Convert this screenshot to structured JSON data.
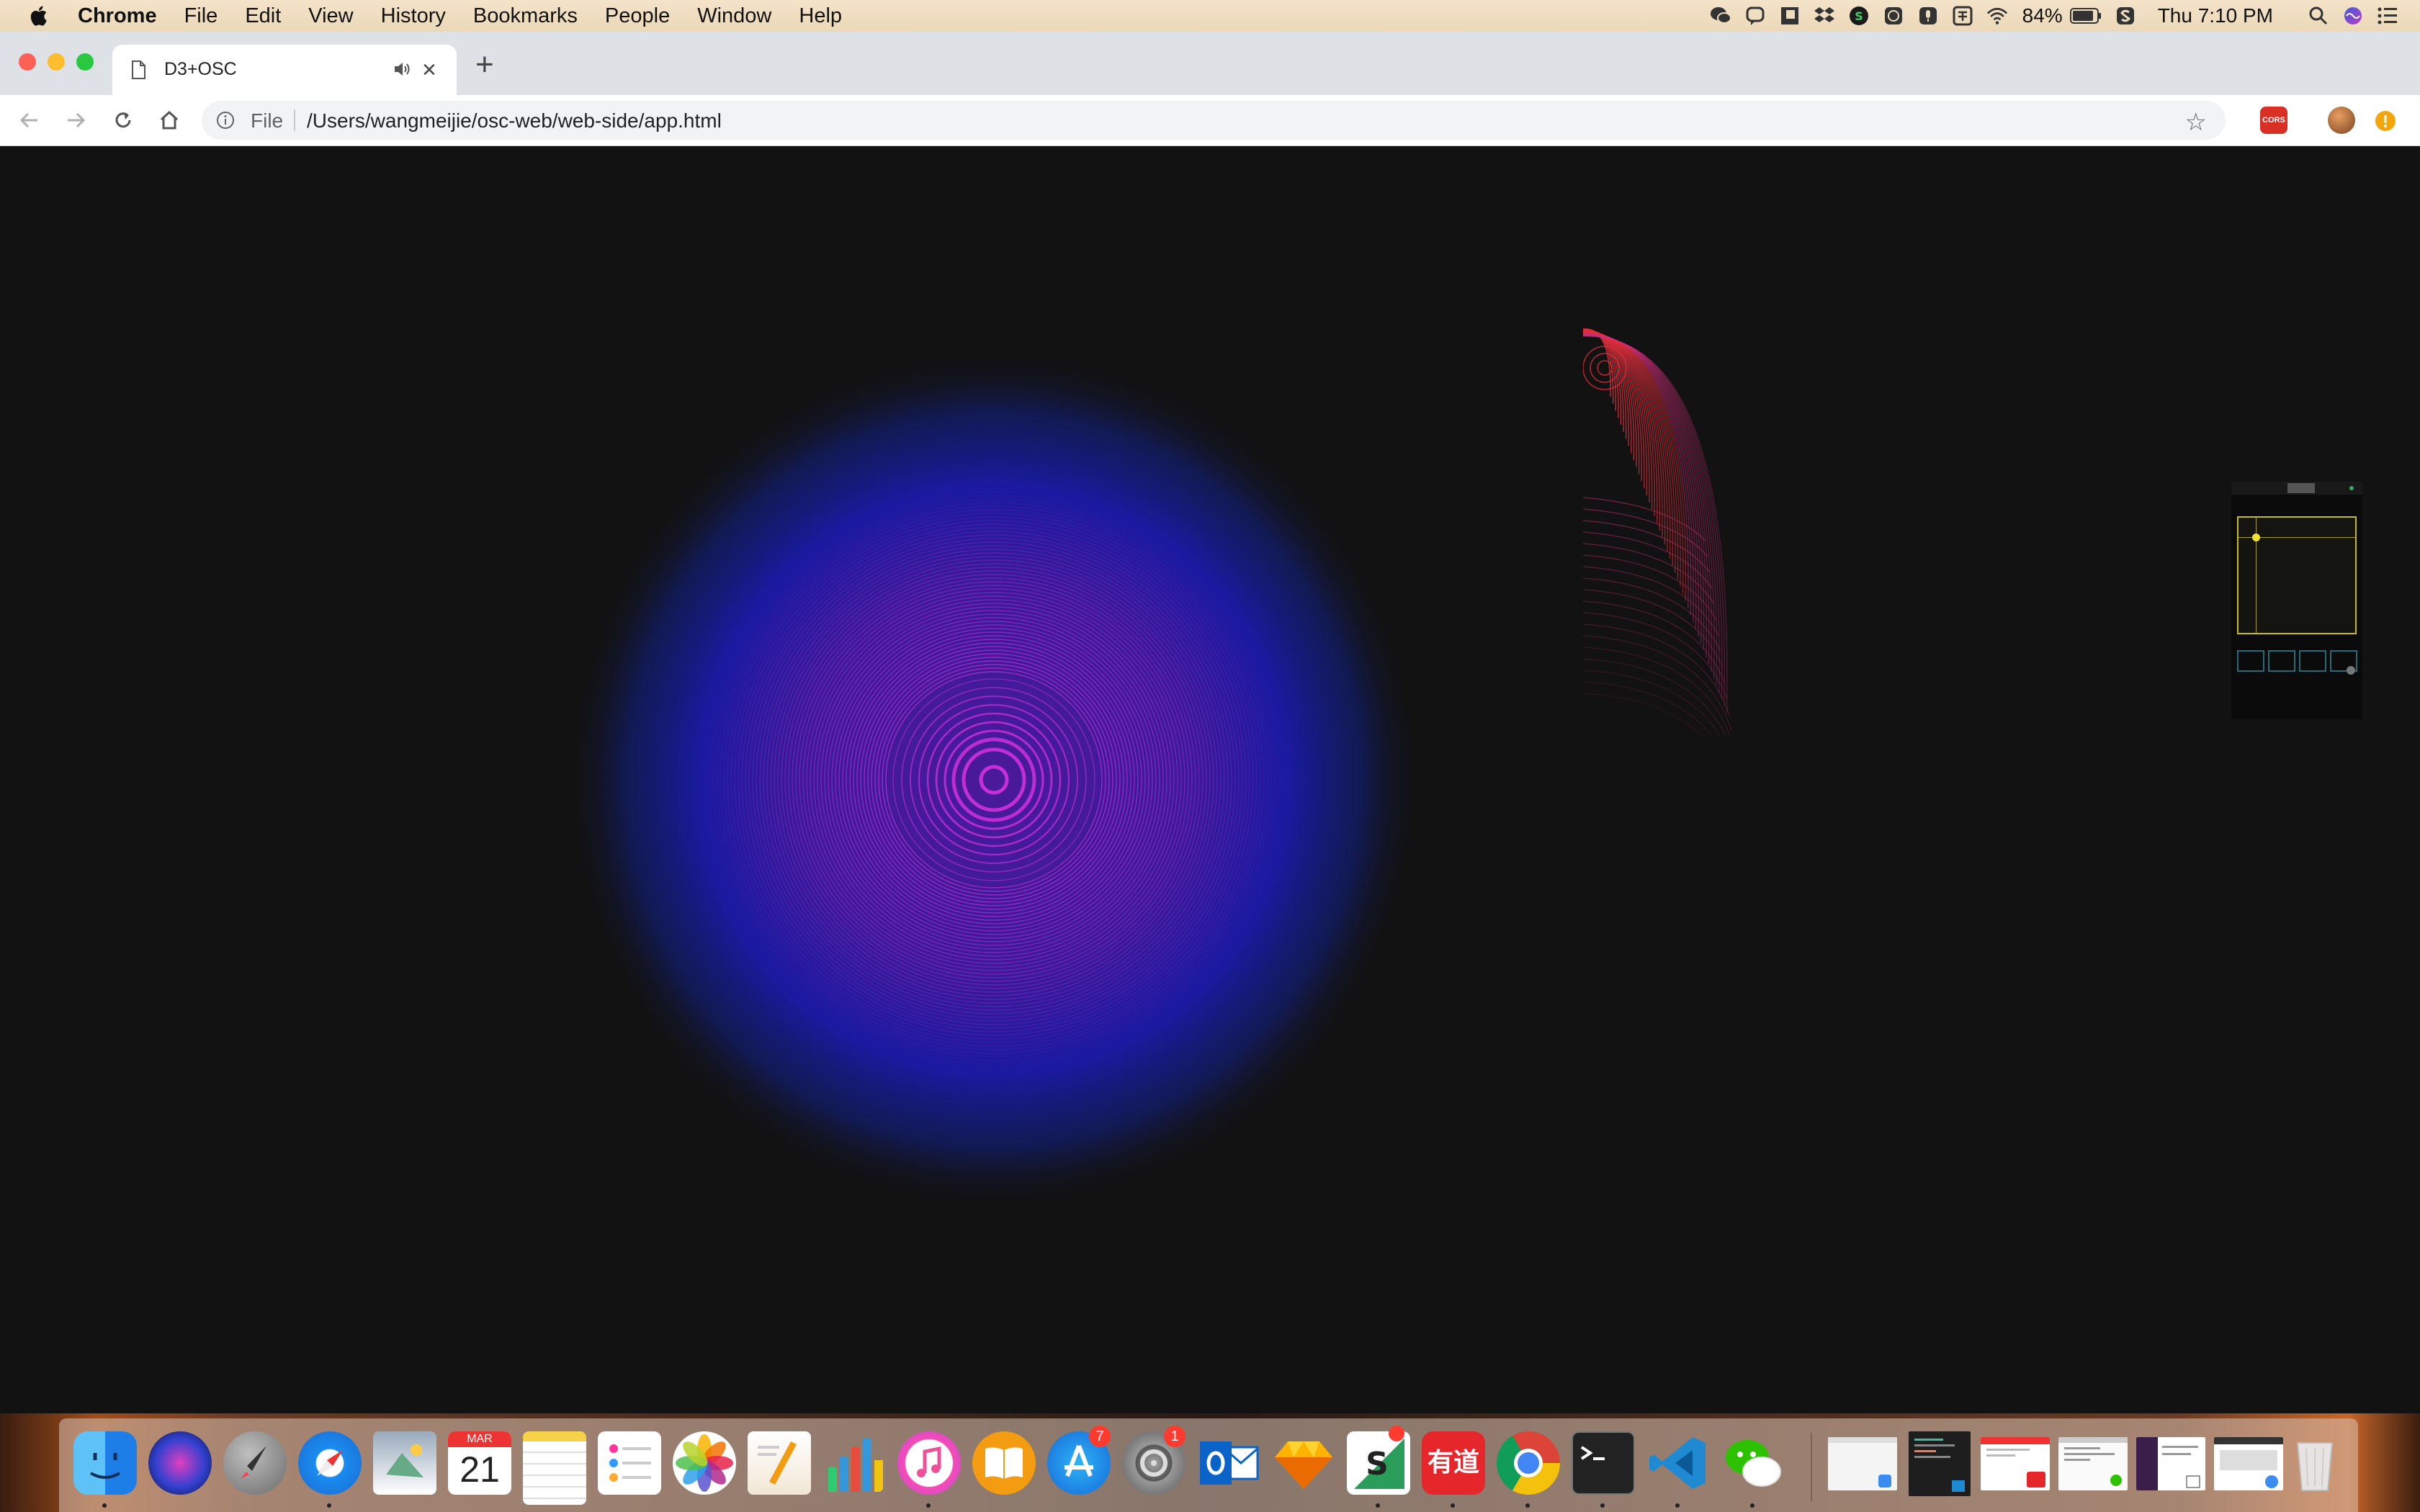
{
  "menubar": {
    "app_name": "Chrome",
    "items": [
      "File",
      "Edit",
      "View",
      "History",
      "Bookmarks",
      "People",
      "Window",
      "Help"
    ],
    "battery": "84%",
    "clock": "Thu 7:10 PM"
  },
  "browser": {
    "tab_title": "D3+OSC",
    "new_tab": "+",
    "scheme_label": "File",
    "url": "/Users/wangmeijie/osc-web/web-side/app.html",
    "ext_badge": "CORS"
  },
  "dock": {
    "calendar_month": "MAR",
    "calendar_day": "21",
    "app_store_badge": "7",
    "settings_badge": "1",
    "youdao_label": "有道",
    "icons": [
      "finder-icon",
      "siri-icon",
      "launchpad-icon",
      "safari-icon",
      "preview-icon",
      "calendar-icon",
      "notes-icon",
      "reminders-icon",
      "photos-icon",
      "pages-icon",
      "numbers-icon",
      "itunes-icon",
      "ibooks-icon",
      "app-store-icon",
      "system-preferences-icon",
      "outlook-icon",
      "sketch-icon",
      "slides-icon",
      "youdao-icon",
      "chrome-icon",
      "terminal-icon",
      "vscode-icon",
      "wechat-icon"
    ]
  },
  "colors": {
    "canvas_bg": "#121212",
    "ring_magenta": "#c82fd8",
    "halo_blue": "#1a1aa0",
    "wave_red": "#e0303c",
    "pad_yellow": "#c8b830"
  }
}
